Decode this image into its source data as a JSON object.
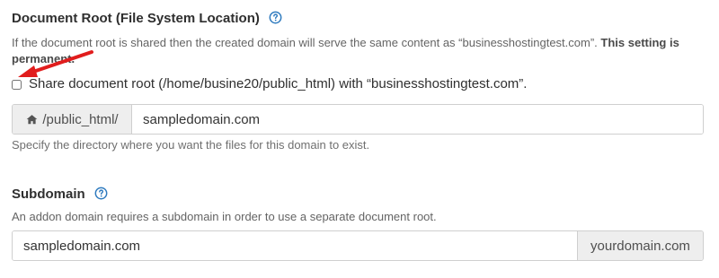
{
  "colors": {
    "help_icon": "#2f7bbf",
    "arrow": "#e11d1d",
    "addon_bg": "#eeeeee",
    "border": "#cfcfcf"
  },
  "sections": {
    "document_root": {
      "title": "Document Root (File System Location)",
      "description_main": "If the document root is shared then the created domain will serve the same content as “businesshostingtest.com”. ",
      "description_strong": "This setting is permanent.",
      "share_checkbox": {
        "label": "Share document root (/home/busine20/public_html) with “businesshostingtest.com”.",
        "checked": false
      },
      "path_input": {
        "prefix_icon": "home-icon",
        "prefix_label": "/public_html/",
        "value": "sampledomain.com"
      },
      "help_text": "Specify the directory where you want the files for this domain to exist."
    },
    "subdomain": {
      "title": "Subdomain",
      "description": "An addon domain requires a subdomain in order to use a separate document root.",
      "input_value": "sampledomain.com",
      "suffix": "yourdomain.com"
    }
  }
}
